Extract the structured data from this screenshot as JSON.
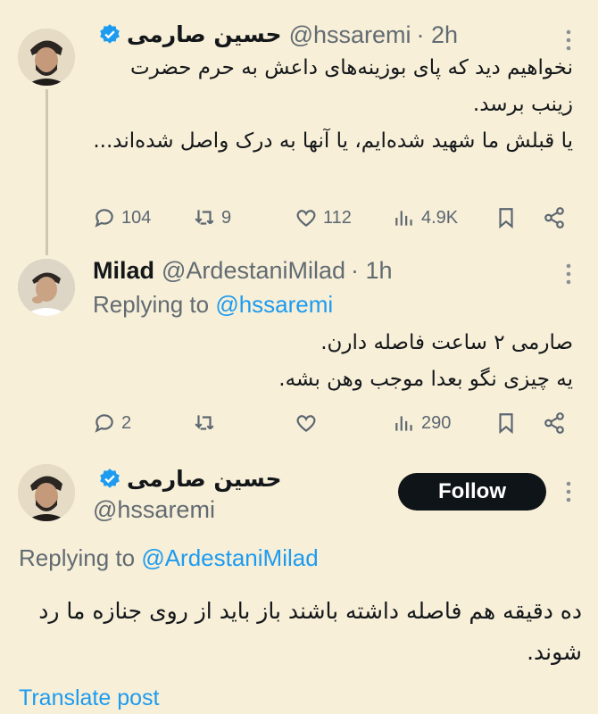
{
  "tweets": [
    {
      "author_name": "حسین صارمی",
      "verified": true,
      "handle": "@hssaremi",
      "time": "· 2h",
      "text_lines": [
        "نخواهیم دید که پای بوزینه‌های داعش به حرم حضرت زینب برسد.",
        "یا قبلش ما شهید شده‌ایم، یا آنها به درک واصل شده‌اند..."
      ],
      "replies": "104",
      "retweets": "9",
      "likes": "112",
      "views": "4.9K"
    },
    {
      "author_name": "Milad",
      "handle": "@ArdestaniMilad",
      "time": "· 1h",
      "replying_prefix": "Replying to",
      "replying_to": "@hssaremi",
      "text_lines": [
        "صارمی ۲ ساعت فاصله دارن.",
        "یه چیزی نگو بعدا موجب وهن بشه."
      ],
      "replies": "2",
      "retweets": "",
      "likes": "",
      "views": "290"
    },
    {
      "author_name": "حسین صارمی",
      "verified": true,
      "handle": "@hssaremi",
      "follow_label": "Follow",
      "replying_prefix": "Replying to",
      "replying_to": "@ArdestaniMilad",
      "text_lines": [
        "ده دقیقه هم فاصله داشته باشند باز باید از روی جنازه ما رد شوند."
      ],
      "translate_label": "Translate post"
    }
  ],
  "icons": {
    "reply": "reply-icon",
    "retweet": "retweet-icon",
    "like": "heart-icon",
    "views": "views-icon",
    "bookmark": "bookmark-icon",
    "share": "share-icon",
    "more": "more-icon",
    "verified": "verified-badge-icon"
  },
  "colors": {
    "background": "#f7efd8",
    "accent": "#1d9bf0",
    "text": "#14171a",
    "secondary_text": "#626b72"
  }
}
